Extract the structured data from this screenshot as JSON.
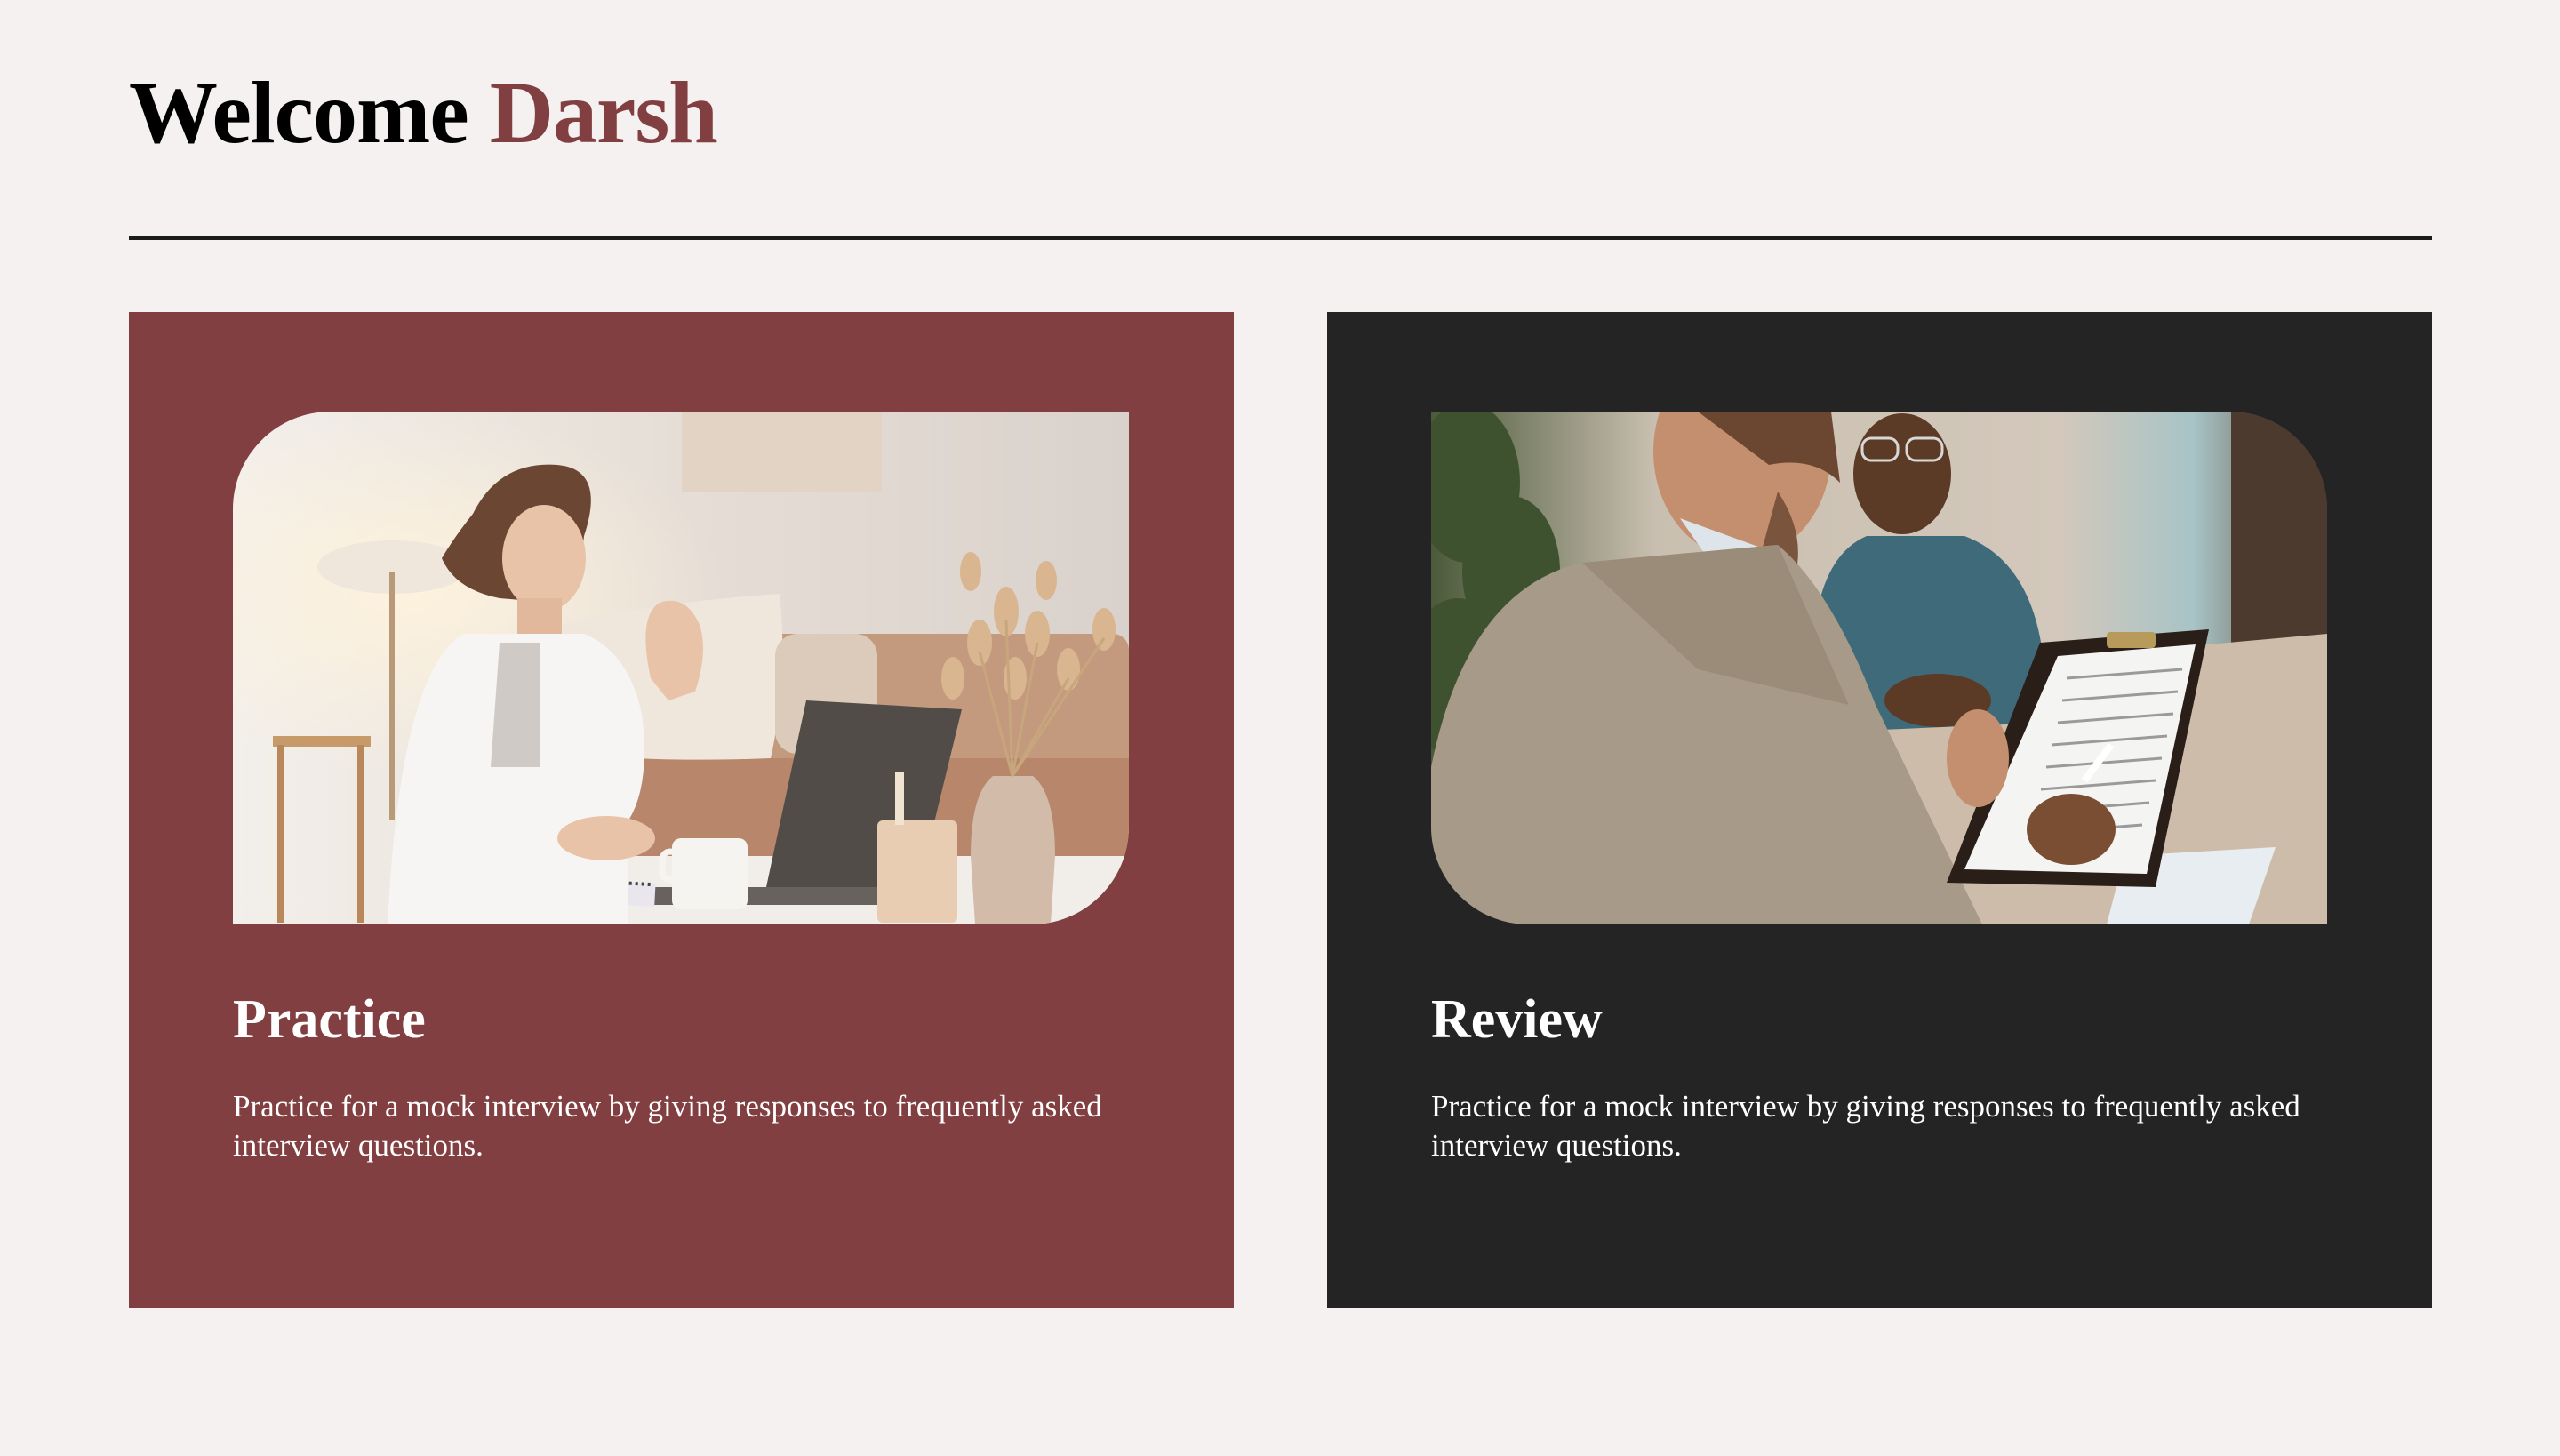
{
  "header": {
    "welcome": "Welcome",
    "user_name": "Darsh"
  },
  "cards": [
    {
      "title": "Practice",
      "description": "Practice for a mock interview by giving responses to frequently asked interview questions.",
      "image": "woman-video-call-photo",
      "background": "#823f41"
    },
    {
      "title": "Review",
      "description": "Practice for a mock interview by giving responses to frequently asked interview questions.",
      "image": "interview-review-photo",
      "background": "#242424"
    }
  ],
  "colors": {
    "accent": "#823f41",
    "page_background": "#f5f1f0",
    "dark_card": "#242424"
  }
}
